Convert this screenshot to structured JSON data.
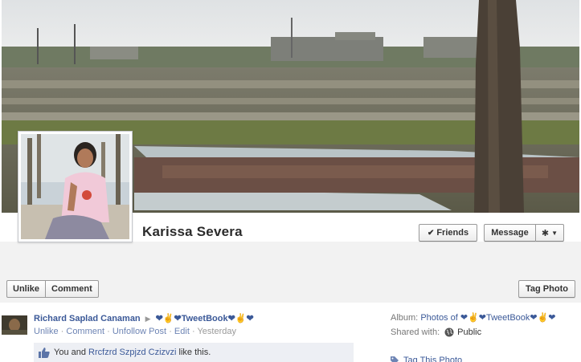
{
  "profile": {
    "name": "Karissa Severa"
  },
  "header_actions": {
    "friends_label": "Friends",
    "message_label": "Message",
    "gear_icon": "gear-icon"
  },
  "photo_actions": {
    "unlike_label": "Unlike",
    "comment_label": "Comment",
    "tag_photo_label": "Tag Photo"
  },
  "story": {
    "author": "Richard Saplad Canaman",
    "target": "❤✌❤TweetBook❤✌❤",
    "meta": {
      "unlike": "Unlike",
      "comment": "Comment",
      "unfollow": "Unfollow Post",
      "edit": "Edit",
      "time": "Yesterday",
      "separator": "·"
    },
    "likes": {
      "prefix": "You and",
      "liker": "Rrcfzrd Szpjzd Czizvzi",
      "suffix": "like this."
    }
  },
  "sidebar": {
    "album_label": "Album:",
    "album_value": "Photos of ❤✌❤TweetBook❤✌❤",
    "shared_label": "Shared with:",
    "shared_value": "Public",
    "tag_link": "Tag This Photo"
  },
  "colors": {
    "link": "#3b5998",
    "muted_link": "#6d84b4",
    "likes_bg": "#edeff4",
    "band_bg": "#f2f2f2"
  }
}
